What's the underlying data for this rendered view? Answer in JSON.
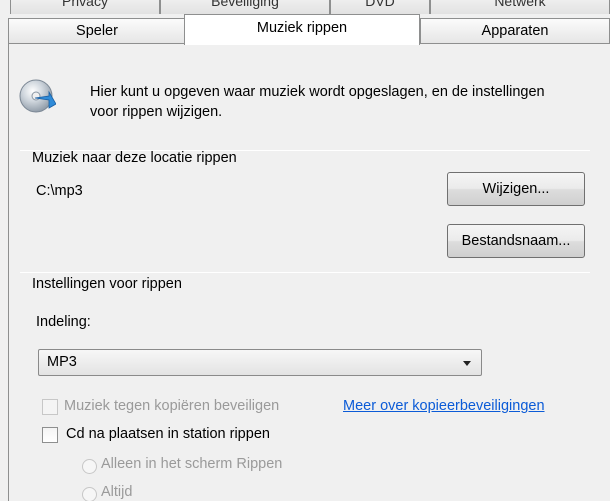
{
  "tabs_back": [
    {
      "label": "Privacy"
    },
    {
      "label": "Beveiliging"
    },
    {
      "label": "DVD"
    },
    {
      "label": "Netwerk"
    }
  ],
  "tabs": [
    {
      "label": "Speler"
    },
    {
      "label": "Muziek rippen"
    },
    {
      "label": "Apparaten"
    }
  ],
  "intro": {
    "text": "Hier kunt u opgeven waar muziek wordt opgeslagen, en de instellingen voor rippen wijzigen."
  },
  "location": {
    "heading": "Muziek naar deze locatie rippen",
    "path": "C:\\mp3",
    "change_label": "Wijzigen...",
    "filename_label": "Bestandsnaam..."
  },
  "settings": {
    "heading": "Instellingen voor rippen",
    "format_label": "Indeling:",
    "format_value": "MP3",
    "copy_protect_label": "Muziek tegen kopiëren beveiligen",
    "copy_protect_link": "Meer over kopieerbeveiligingen",
    "rip_cd_label": "Cd na plaatsen in station rippen",
    "radio_only_tab": "Alleen in het scherm Rippen",
    "radio_always": "Altijd"
  }
}
